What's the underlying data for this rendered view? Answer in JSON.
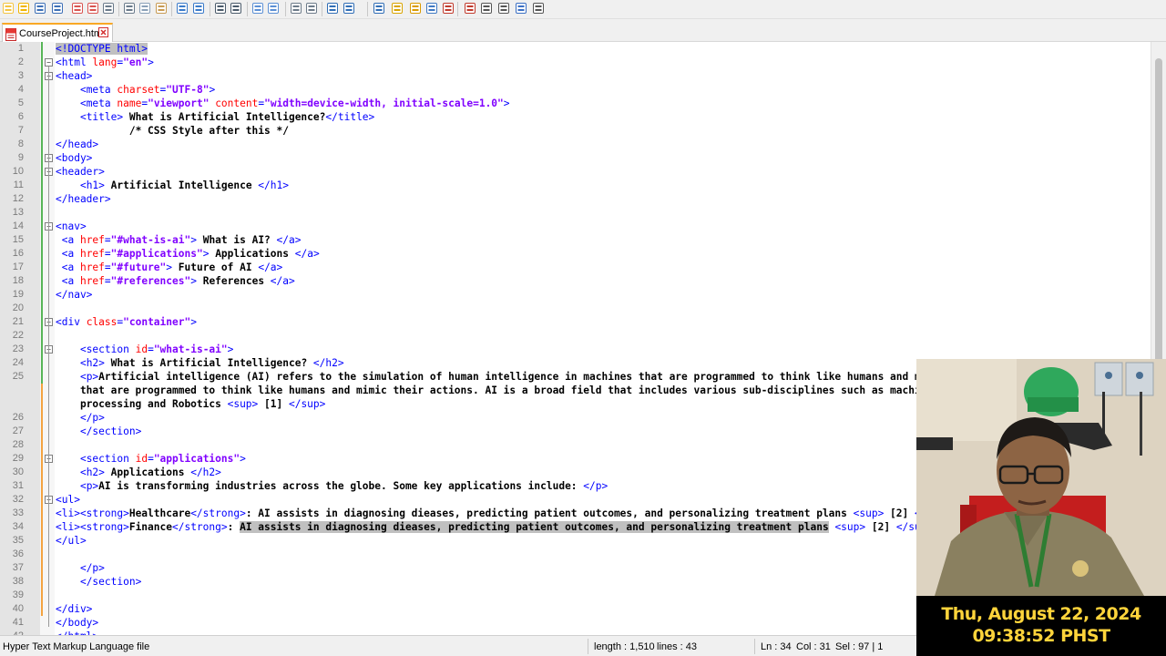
{
  "toolbar": {
    "icons": [
      "new-file-icon",
      "open-file-icon",
      "save-icon",
      "save-all-icon",
      "close-icon",
      "close-all-icon",
      "print-icon",
      "cut-icon",
      "copy-icon",
      "paste-icon",
      "undo-icon",
      "redo-icon",
      "find-icon",
      "replace-icon",
      "zoom-in-icon",
      "zoom-out-icon",
      "sync-vertical-icon",
      "sync-horizontal-icon",
      "word-wrap-icon",
      "show-all-characters-icon",
      "indent-guide-icon",
      "function-list-icon",
      "folder-workspace-icon",
      "document-map-icon",
      "monitoring-icon",
      "record-macro-icon",
      "stop-recording-icon",
      "play-macro-icon",
      "run-macro-multiple-icon",
      "save-macro-icon"
    ]
  },
  "tabs": [
    {
      "label": "CourseProject.html",
      "active": true
    }
  ],
  "editor": {
    "lines": [
      {
        "n": "1",
        "parts": [
          [
            "hl t",
            "<!DOCTYPE html>"
          ]
        ]
      },
      {
        "n": "2",
        "parts": [
          [
            "t",
            "<html "
          ],
          [
            "a",
            "lang"
          ],
          [
            "t",
            "="
          ],
          [
            "v",
            "\"en\""
          ],
          [
            "t",
            ">"
          ]
        ]
      },
      {
        "n": "3",
        "parts": [
          [
            "t",
            "<head>"
          ]
        ]
      },
      {
        "n": "4",
        "parts": [
          [
            "",
            "    "
          ],
          [
            "t",
            "<meta "
          ],
          [
            "a",
            "charset"
          ],
          [
            "t",
            "="
          ],
          [
            "v",
            "\"UTF-8\""
          ],
          [
            "t",
            ">"
          ]
        ]
      },
      {
        "n": "5",
        "parts": [
          [
            "",
            "    "
          ],
          [
            "t",
            "<meta "
          ],
          [
            "a",
            "name"
          ],
          [
            "t",
            "="
          ],
          [
            "v",
            "\"viewport\""
          ],
          [
            "t",
            " "
          ],
          [
            "a",
            "content"
          ],
          [
            "t",
            "="
          ],
          [
            "v",
            "\"width=device-width, initial-scale=1.0\""
          ],
          [
            "t",
            ">"
          ]
        ]
      },
      {
        "n": "6",
        "parts": [
          [
            "",
            "    "
          ],
          [
            "t",
            "<title>"
          ],
          [
            "txt",
            " What is Artificial Intelligence?"
          ],
          [
            "t",
            "</title>"
          ]
        ]
      },
      {
        "n": "7",
        "parts": [
          [
            "",
            "            "
          ],
          [
            "cmt",
            "/* CSS Style after this */"
          ]
        ]
      },
      {
        "n": "8",
        "parts": [
          [
            "t",
            "</head>"
          ]
        ]
      },
      {
        "n": "9",
        "parts": [
          [
            "t",
            "<body>"
          ]
        ]
      },
      {
        "n": "10",
        "parts": [
          [
            "t",
            "<header>"
          ]
        ]
      },
      {
        "n": "11",
        "parts": [
          [
            "",
            "    "
          ],
          [
            "t",
            "<h1>"
          ],
          [
            "txt",
            " Artificial Intelligence "
          ],
          [
            "t",
            "</h1>"
          ]
        ]
      },
      {
        "n": "12",
        "parts": [
          [
            "t",
            "</header>"
          ]
        ]
      },
      {
        "n": "13",
        "parts": []
      },
      {
        "n": "14",
        "parts": [
          [
            "t",
            "<nav>"
          ]
        ]
      },
      {
        "n": "15",
        "parts": [
          [
            "t",
            " <a "
          ],
          [
            "a",
            "href"
          ],
          [
            "t",
            "="
          ],
          [
            "v",
            "\"#what-is-ai\""
          ],
          [
            "t",
            ">"
          ],
          [
            "txt",
            " What is AI? "
          ],
          [
            "t",
            "</a>"
          ]
        ]
      },
      {
        "n": "16",
        "parts": [
          [
            "t",
            " <a "
          ],
          [
            "a",
            "href"
          ],
          [
            "t",
            "="
          ],
          [
            "v",
            "\"#applications\""
          ],
          [
            "t",
            ">"
          ],
          [
            "txt",
            " Applications "
          ],
          [
            "t",
            "</a>"
          ]
        ]
      },
      {
        "n": "17",
        "parts": [
          [
            "t",
            " <a "
          ],
          [
            "a",
            "href"
          ],
          [
            "t",
            "="
          ],
          [
            "v",
            "\"#future\""
          ],
          [
            "t",
            ">"
          ],
          [
            "txt",
            " Future of AI "
          ],
          [
            "t",
            "</a>"
          ]
        ]
      },
      {
        "n": "18",
        "parts": [
          [
            "t",
            " <a "
          ],
          [
            "a",
            "href"
          ],
          [
            "t",
            "="
          ],
          [
            "v",
            "\"#references\""
          ],
          [
            "t",
            ">"
          ],
          [
            "txt",
            " References "
          ],
          [
            "t",
            "</a>"
          ]
        ]
      },
      {
        "n": "19",
        "parts": [
          [
            "t",
            "</nav>"
          ]
        ]
      },
      {
        "n": "20",
        "parts": []
      },
      {
        "n": "21",
        "parts": [
          [
            "t",
            "<div "
          ],
          [
            "a",
            "class"
          ],
          [
            "t",
            "="
          ],
          [
            "v",
            "\"container\""
          ],
          [
            "t",
            ">"
          ]
        ]
      },
      {
        "n": "22",
        "parts": []
      },
      {
        "n": "23",
        "parts": [
          [
            "",
            "    "
          ],
          [
            "t",
            "<section "
          ],
          [
            "a",
            "id"
          ],
          [
            "t",
            "="
          ],
          [
            "v",
            "\"what-is-ai\""
          ],
          [
            "t",
            ">"
          ]
        ]
      },
      {
        "n": "24",
        "parts": [
          [
            "",
            "    "
          ],
          [
            "t",
            "<h2>"
          ],
          [
            "txt",
            " What is Artificial Intelligence? "
          ],
          [
            "t",
            "</h2>"
          ]
        ]
      },
      {
        "n": "25",
        "parts": [
          [
            "",
            "    "
          ],
          [
            "t",
            "<p>"
          ],
          [
            "txt",
            "Artificial intelligence (AI) refers to the simulation of human intelligence in machines that are programmed to think like humans and mi"
          ]
        ]
      },
      {
        "n": "",
        "parts": [
          [
            "txt",
            "    that are programmed to think like humans and mimic their actions. AI is a broad field that includes various sub-disciplines such as machin"
          ]
        ]
      },
      {
        "n": "",
        "parts": [
          [
            "txt",
            "    processing and Robotics "
          ],
          [
            "t",
            "<sup>"
          ],
          [
            "txt",
            " [1] "
          ],
          [
            "t",
            "</sup>"
          ]
        ]
      },
      {
        "n": "26",
        "parts": [
          [
            "",
            "    "
          ],
          [
            "t",
            "</p>"
          ]
        ]
      },
      {
        "n": "27",
        "parts": [
          [
            "",
            "    "
          ],
          [
            "t",
            "</section>"
          ]
        ]
      },
      {
        "n": "28",
        "parts": []
      },
      {
        "n": "29",
        "parts": [
          [
            "",
            "    "
          ],
          [
            "t",
            "<section "
          ],
          [
            "a",
            "id"
          ],
          [
            "t",
            "="
          ],
          [
            "v",
            "\"applications\""
          ],
          [
            "t",
            ">"
          ]
        ]
      },
      {
        "n": "30",
        "parts": [
          [
            "",
            "    "
          ],
          [
            "t",
            "<h2>"
          ],
          [
            "txt",
            " Applications "
          ],
          [
            "t",
            "</h2>"
          ]
        ]
      },
      {
        "n": "31",
        "parts": [
          [
            "",
            "    "
          ],
          [
            "t",
            "<p>"
          ],
          [
            "txt",
            "AI is transforming industries across the globe. Some key applications include: "
          ],
          [
            "t",
            "</p>"
          ]
        ]
      },
      {
        "n": "32",
        "parts": [
          [
            "t",
            "<ul>"
          ]
        ]
      },
      {
        "n": "33",
        "parts": [
          [
            "t",
            "<li><strong>"
          ],
          [
            "txt",
            "Healthcare"
          ],
          [
            "t",
            "</strong>"
          ],
          [
            "txt",
            ": AI assists in diagnosing dieases, predicting patient outcomes, and personalizing treatment plans "
          ],
          [
            "t",
            "<sup>"
          ],
          [
            "txt",
            " [2] "
          ],
          [
            "t",
            "</"
          ]
        ]
      },
      {
        "n": "34",
        "parts": [
          [
            "t",
            "<li><strong>"
          ],
          [
            "txt",
            "Finance"
          ],
          [
            "t",
            "</strong>"
          ],
          [
            "txt",
            ": "
          ],
          [
            "hl txt",
            "AI assists in diagnosing dieases, predicting patient outcomes, and personalizing treatment plans"
          ],
          [
            "t",
            " <sup>"
          ],
          [
            "txt",
            " [2] "
          ],
          [
            "t",
            "</sup"
          ]
        ]
      },
      {
        "n": "35",
        "parts": [
          [
            "t",
            "</ul>"
          ]
        ]
      },
      {
        "n": "36",
        "parts": []
      },
      {
        "n": "37",
        "parts": [
          [
            "",
            "    "
          ],
          [
            "t",
            "</p>"
          ]
        ]
      },
      {
        "n": "38",
        "parts": [
          [
            "",
            "    "
          ],
          [
            "t",
            "</section>"
          ]
        ]
      },
      {
        "n": "39",
        "parts": []
      },
      {
        "n": "40",
        "parts": [
          [
            "t",
            "</div>"
          ]
        ]
      },
      {
        "n": "41",
        "parts": [
          [
            "t",
            "</body>"
          ]
        ]
      },
      {
        "n": "42",
        "parts": [
          [
            "t",
            "</html>"
          ]
        ]
      }
    ]
  },
  "statusbar": {
    "file_type": "Hyper Text Markup Language file",
    "length": "length : 1,510",
    "lines": "lines : 43",
    "ln": "Ln : 34",
    "col": "Col : 31",
    "sel": "Sel : 97 | 1"
  },
  "overlay": {
    "date": "Thu, August 22, 2024",
    "time": "09:38:52 PHST"
  },
  "colors": {
    "tag": "#0000ff",
    "attribute": "#ff0000",
    "value": "#8000ff",
    "overlay_text": "#ffd43b"
  }
}
